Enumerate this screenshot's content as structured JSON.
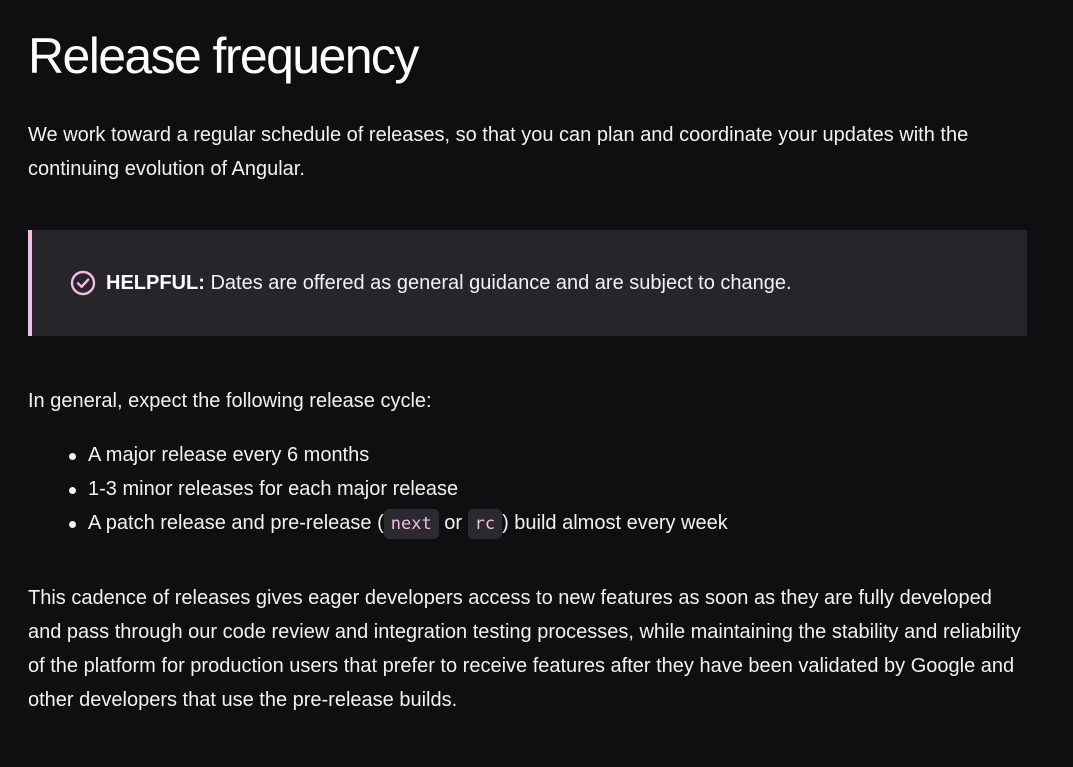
{
  "heading": "Release frequency",
  "intro": "We work toward a regular schedule of releases, so that you can plan and coordinate your updates with the continuing evolution of Angular.",
  "callout": {
    "icon": "check-circle-icon",
    "label": "HELPFUL:",
    "text": " Dates are offered as general guidance and are subject to change.",
    "accent_color": "#f4bde9",
    "background_color": "#27242a"
  },
  "lead": "In general, expect the following release cycle:",
  "cycle": {
    "items": [
      "A major release every 6 months",
      "1-3 minor releases for each major release"
    ],
    "patch": {
      "before": "A patch release and pre-release (",
      "code_next": "next",
      "middle": " or ",
      "code_rc": "rc",
      "after": ") build almost every week"
    }
  },
  "closing": "This cadence of releases gives eager developers access to new features as soon as they are fully developed and pass through our code review and integration testing processes, while maintaining the stability and reliability of the platform for production users that prefer to receive features after they have been validated by Google and other developers that use the pre-release builds."
}
